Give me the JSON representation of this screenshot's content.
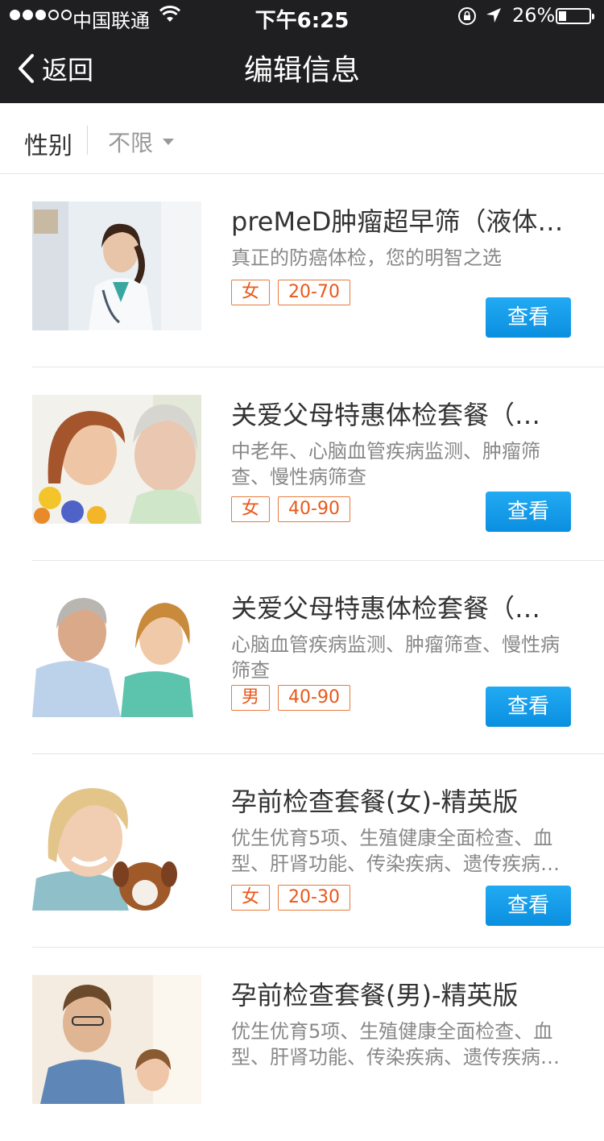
{
  "status_bar": {
    "carrier": "中国联通",
    "time": "下午6:25",
    "battery_percent": "26%",
    "battery_level": 0.26,
    "icons": [
      "signal-icon",
      "wifi-icon",
      "orientation-lock-icon",
      "location-icon",
      "battery-icon"
    ]
  },
  "nav": {
    "back_label": "返回",
    "title": "编辑信息"
  },
  "filter": {
    "label": "性别",
    "value": "不限"
  },
  "items": [
    {
      "title": "preMeD肿瘤超早筛（液体…",
      "desc": "真正的防癌体检，您的明智之选",
      "gender": "女",
      "age": "20-70",
      "button": "查看"
    },
    {
      "title": "关爱父母特惠体检套餐（…",
      "desc": "中老年、心脑血管疾病监测、肿瘤筛查、慢性病筛查",
      "gender": "女",
      "age": "40-90",
      "button": "查看"
    },
    {
      "title": "关爱父母特惠体检套餐（…",
      "desc": "心脑血管疾病监测、肿瘤筛查、慢性病筛查",
      "gender": "男",
      "age": "40-90",
      "button": "查看"
    },
    {
      "title": "孕前检查套餐(女)-精英版",
      "desc": "优生优育5项、生殖健康全面检查、血型、肝肾功能、传染疾病、遗传疾病…",
      "gender": "女",
      "age": "20-30",
      "button": "查看"
    },
    {
      "title": "孕前检查套餐(男)-精英版",
      "desc": "优生优育5项、生殖健康全面检查、血型、肝肾功能、传染疾病、遗传疾病…",
      "gender": "",
      "age": "",
      "button": ""
    }
  ]
}
